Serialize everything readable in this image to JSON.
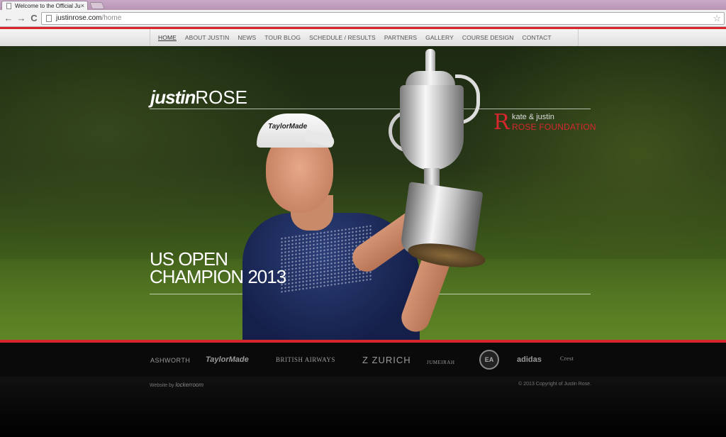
{
  "browser": {
    "tab_title": "Welcome to the Official Ju",
    "tab_close": "×",
    "back": "←",
    "forward": "→",
    "reload": "C",
    "url_host": "justinrose.com",
    "url_path": "/home",
    "star": "☆"
  },
  "nav": {
    "items": [
      "HOME",
      "ABOUT JUSTIN",
      "NEWS",
      "TOUR BLOG",
      "SCHEDULE / RESULTS",
      "PARTNERS",
      "GALLERY",
      "COURSE DESIGN",
      "CONTACT"
    ]
  },
  "hero": {
    "logo_bold": "justin",
    "logo_light": "ROSE",
    "foundation_mark": "R",
    "foundation_line1": "kate & justin",
    "foundation_line2": "ROSE FOUNDATION",
    "headline_line1": "US OPEN",
    "headline_line2": "CHAMPION 2013",
    "cap_brand": "TaylorMade"
  },
  "partners": {
    "items": [
      "ASHWORTH",
      "TaylorMade",
      "BRITISH AIRWAYS",
      "Z ZURICH",
      "JUMEIRAH",
      "EA",
      "adidas",
      "Crest"
    ]
  },
  "footer": {
    "credit_prefix": "Website by",
    "credit_brand": "lockerroom",
    "copyright": "© 2013 Copyright of Justin Rose."
  },
  "colors": {
    "accent_red": "#d8262e"
  }
}
